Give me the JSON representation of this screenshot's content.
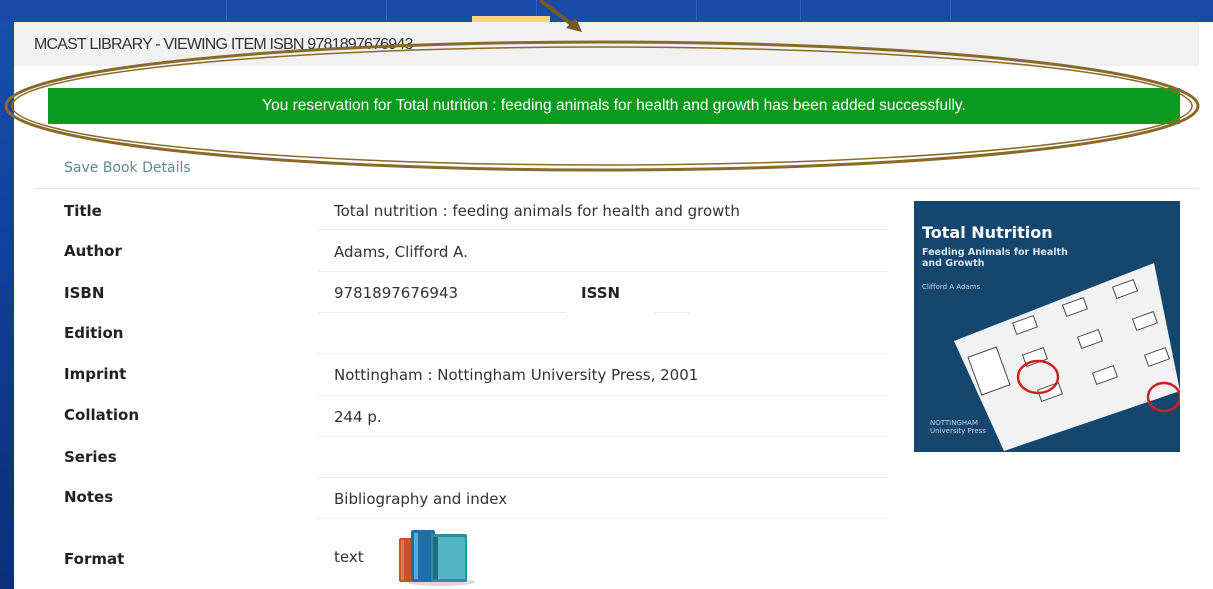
{
  "header": {
    "page_title": "MCAST LIBRARY - VIEWING ITEM ISBN 9781897676943"
  },
  "notification": {
    "message": "You reservation for Total nutrition : feeding animals for health and growth has been added successfully."
  },
  "actions": {
    "save_label": "Save Book Details"
  },
  "details": {
    "title_label": "Title",
    "title_value": "Total nutrition : feeding animals for health and growth",
    "author_label": "Author",
    "author_value": "Adams, Clifford A.",
    "isbn_label": "ISBN",
    "isbn_value": "9781897676943",
    "issn_label": "ISSN",
    "issn_value": "",
    "edition_label": "Edition",
    "edition_value": "",
    "imprint_label": "Imprint",
    "imprint_value": "Nottingham : Nottingham University Press, 2001",
    "collation_label": "Collation",
    "collation_value": "244 p.",
    "series_label": "Series",
    "series_value": "",
    "notes_label": "Notes",
    "notes_value": "Bibliography and index",
    "format_label": "Format",
    "format_value": "text"
  },
  "cover": {
    "title": "Total Nutrition",
    "subtitle_line1": "Feeding Animals for Health",
    "subtitle_line2": "and Growth",
    "author": "Clifford A Adams",
    "publisher_line1": "NOTTINGHAM",
    "publisher_line2": "University Press"
  },
  "icons": {
    "format": "books-icon"
  },
  "colors": {
    "banner": "#0a9a1e",
    "frame": "#1a4fb0",
    "annotation": "#8a6a2a",
    "cover": "#15466e"
  }
}
